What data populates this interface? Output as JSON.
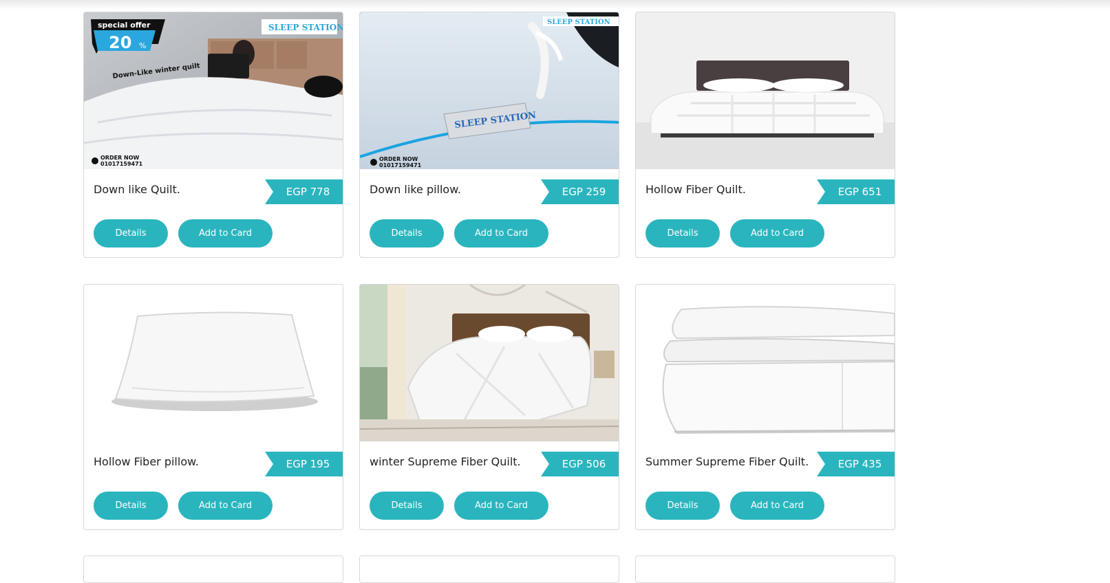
{
  "products": [
    {
      "title": "Down like Quilt.",
      "price": "EGP 778",
      "details_label": "Details",
      "add_label": "Add to Card",
      "image_text": {
        "offer_line1": "special offer",
        "offer_pct": "20",
        "offer_sym": "%",
        "caption": "Down-Like winter quilt",
        "brand": "SLEEP STATION",
        "order_now": "ORDER NOW",
        "phone": "01017159471"
      }
    },
    {
      "title": "Down like pillow.",
      "price": "EGP 259",
      "details_label": "Details",
      "add_label": "Add to Card",
      "image_text": {
        "brand": "SLEEP STATION",
        "tag": "SLEEP STATION",
        "order_now": "ORDER NOW",
        "phone": "01017159471"
      }
    },
    {
      "title": "Hollow Fiber Quilt.",
      "price": "EGP 651",
      "details_label": "Details",
      "add_label": "Add to Card"
    },
    {
      "title": "Hollow Fiber pillow.",
      "price": "EGP 195",
      "details_label": "Details",
      "add_label": "Add to Card"
    },
    {
      "title": "winter Supreme Fiber Quilt.",
      "price": "EGP 506",
      "details_label": "Details",
      "add_label": "Add to Card"
    },
    {
      "title": "Summer Supreme Fiber Quilt.",
      "price": "EGP 435",
      "details_label": "Details",
      "add_label": "Add to Card"
    }
  ],
  "colors": {
    "accent": "#2ab5be",
    "border": "#d7d7d7",
    "text": "#222222"
  }
}
